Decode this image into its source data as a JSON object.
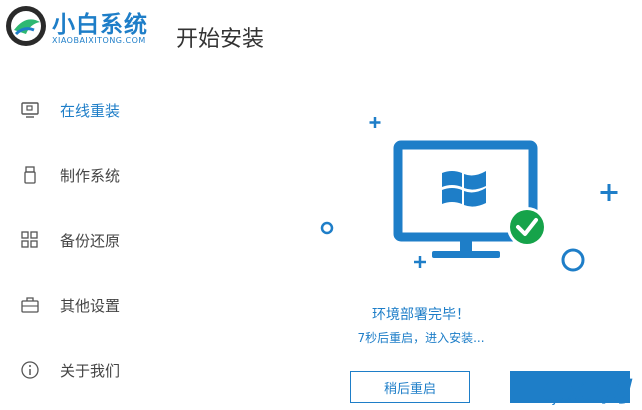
{
  "brand": {
    "name": "小白系统",
    "domain": "XIAOBAIXITONG.COM"
  },
  "page_title": "开始安装",
  "sidebar": {
    "items": [
      {
        "label": "在线重装",
        "icon": "monitor-icon",
        "active": true
      },
      {
        "label": "制作系统",
        "icon": "usb-drive-icon",
        "active": false
      },
      {
        "label": "备份还原",
        "icon": "grid-backup-icon",
        "active": false
      },
      {
        "label": "其他设置",
        "icon": "briefcase-icon",
        "active": false
      },
      {
        "label": "关于我们",
        "icon": "info-icon",
        "active": false
      }
    ]
  },
  "main": {
    "illustration": "monitor-with-windows-logo-and-checkmark",
    "status": "环境部署完毕！",
    "countdown": "7秒后重启，进入安装...",
    "buttons": {
      "restart_later": "稍后重启",
      "restart_now": ""
    }
  },
  "watermark": {
    "main": "GXI网",
    "sub": "system.com"
  },
  "colors": {
    "accent": "#1e7ec8",
    "success": "#16a34a",
    "text": "#444444"
  }
}
